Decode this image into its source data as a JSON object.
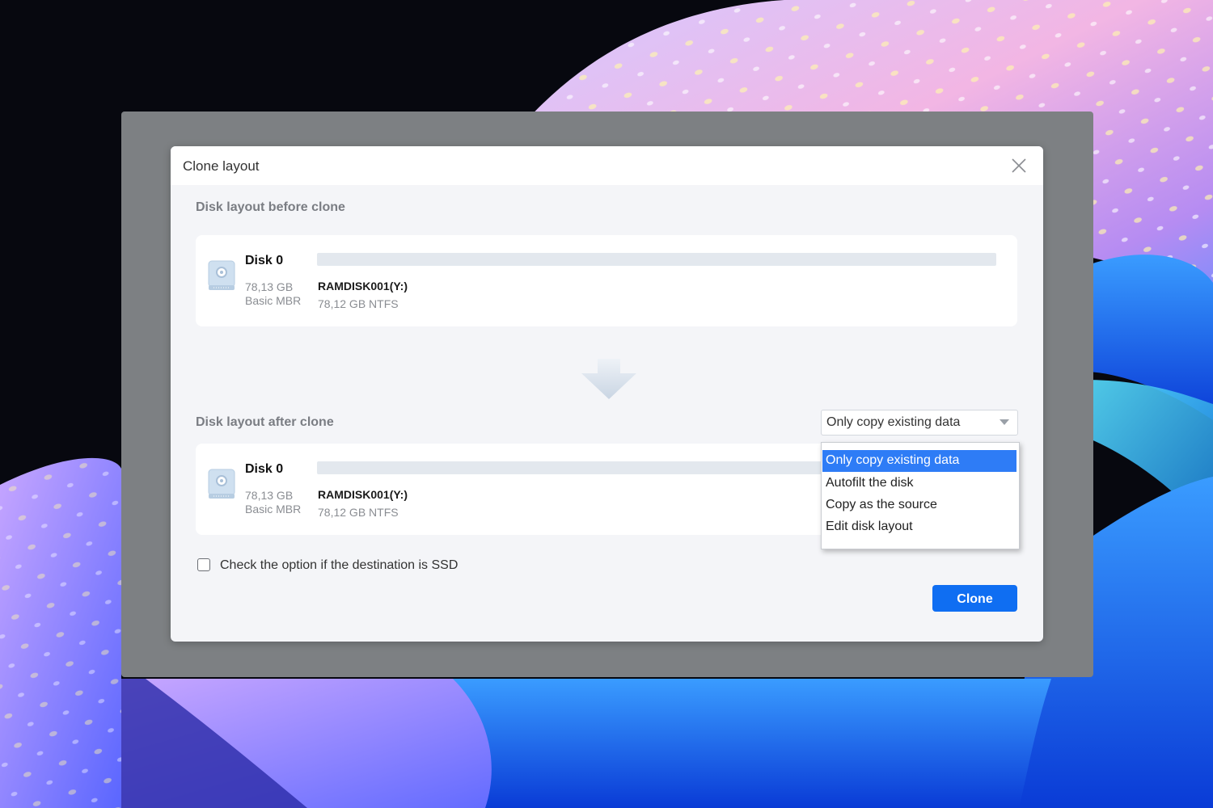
{
  "dialog": {
    "title": "Clone layout",
    "close_icon": "close-icon"
  },
  "before": {
    "section_label": "Disk layout before clone",
    "disk": {
      "name": "Disk 0",
      "size": "78,13 GB",
      "type": "Basic MBR",
      "icon": "hard-disk-icon",
      "partition": {
        "name": "RAMDISK001(Y:)",
        "info": "78,12 GB NTFS"
      }
    }
  },
  "arrow_icon": "arrow-down-icon",
  "after": {
    "section_label": "Disk layout after clone",
    "disk": {
      "name": "Disk 0",
      "size": "78,13 GB",
      "type": "Basic MBR",
      "icon": "hard-disk-icon",
      "partition": {
        "name": "RAMDISK001(Y:)",
        "info": "78,12 GB NTFS"
      }
    }
  },
  "clone_mode": {
    "selected": "Only copy existing data",
    "options": [
      "Only copy existing data",
      "Autofilt the disk",
      "Copy as the source",
      "Edit disk layout"
    ]
  },
  "ssd_option": {
    "label": "Check the option if the destination is SSD",
    "checked": false
  },
  "clone_button": "Clone",
  "colors": {
    "accent": "#0f6ef2",
    "selection": "#2e7cf6",
    "dialog_bg": "#f4f5f8",
    "frame": "#7d8083"
  }
}
